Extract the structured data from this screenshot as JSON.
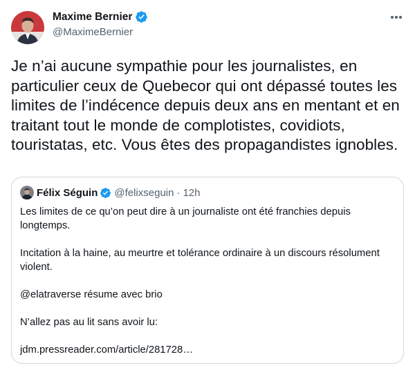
{
  "author": {
    "display_name": "Maxime Bernier",
    "handle": "@MaximeBernier"
  },
  "tweet": {
    "text": "Je n’ai aucune sympathie pour les journalistes, en particulier ceux de Quebecor qui ont dépassé toutes les limites de l’indécence depuis deux ans en mentant et en traitant tout le monde de complotistes, covidiots, touristatas, etc. Vous êtes des propagandistes ignobles."
  },
  "quoted_tweet": {
    "display_name": "Félix Séguin",
    "handle": "@felixseguin",
    "separator": "·",
    "time": "12h",
    "paragraphs": [
      "Les limites de ce qu’on peut dire à un journaliste ont été franchies depuis longtemps.",
      "",
      "Incitation à la haine, au meurtre et tolérance ordinaire à un discours résolument violent.",
      "",
      "@elatraverse résume avec brio",
      "",
      "N’allez pas au lit sans avoir lu:",
      "",
      "jdm.pressreader.com/article/281728…"
    ]
  },
  "icons": {
    "verified": "verified-badge-icon",
    "more": "more-horizontal-icon"
  },
  "colors": {
    "verified_blue": "#1d9bf0",
    "secondary_text": "#536471",
    "border": "#cfd9de"
  }
}
